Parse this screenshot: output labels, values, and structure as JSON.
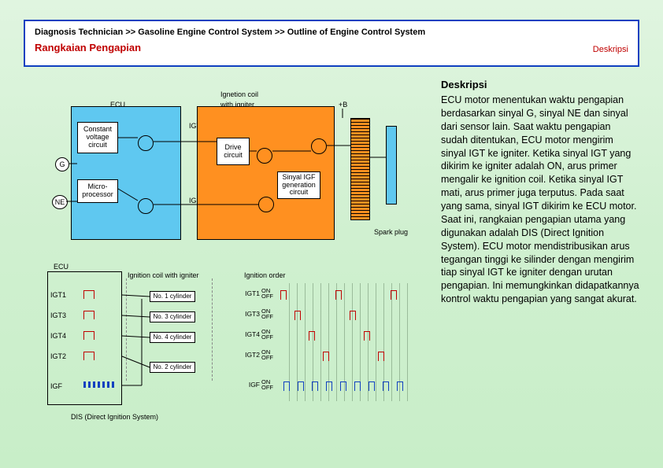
{
  "header": {
    "breadcrumb": "Diagnosis Technician >> Gasoline Engine Control System >> Outline of Engine Control System",
    "subtitle": "Rangkaian Pengapian",
    "right_label": "Deskripsi"
  },
  "diagram_top": {
    "title_ignetion": "Ignetion coil",
    "title_with_igniter": "with igniter",
    "ecu_label": "ECU",
    "plus_b": "+B",
    "cvc": "Constant voltage circuit",
    "micro": "Micro-processor",
    "drive": "Drive circuit",
    "igf_gen": "Sinyal IGF generation circuit",
    "igt": "IGT",
    "igf": "IGF",
    "g": "G",
    "ne": "NE",
    "spark": "Spark plug"
  },
  "diagram_bottom": {
    "ecu": "ECU",
    "signals": [
      {
        "name": "IGT1",
        "color": "red"
      },
      {
        "name": "IGT3",
        "color": "red"
      },
      {
        "name": "IGT4",
        "color": "red"
      },
      {
        "name": "IGT2",
        "color": "red"
      },
      {
        "name": "IGF",
        "color": "blue"
      }
    ],
    "ign_coil_title": "Ignition coil with igniter",
    "cylinders": [
      "No. 1 cylinder",
      "No. 3 cylinder",
      "No. 4 cylinder",
      "No. 2 cylinder"
    ],
    "order_title": "Ignition order",
    "order": [
      {
        "name": "IGT1",
        "on": "ON",
        "off": "OFF"
      },
      {
        "name": "IGT3",
        "on": "ON",
        "off": "OFF"
      },
      {
        "name": "IGT4",
        "on": "ON",
        "off": "OFF"
      },
      {
        "name": "IGT2",
        "on": "ON",
        "off": "OFF"
      },
      {
        "name": "IGF",
        "on": "ON",
        "off": "OFF"
      }
    ],
    "dis_label": "DIS (Direct Ignition System)"
  },
  "description": {
    "heading": "Deskripsi",
    "body": "ECU motor menentukan waktu pengapian berdasarkan sinyal G, sinyal NE dan sinyal dari sensor lain. Saat waktu pengapian sudah ditentukan, ECU motor mengirim sinyal IGT ke igniter. Ketika sinyal IGT yang dikirim ke igniter adalah ON, arus primer mengalir ke ignition coil. Ketika sinyal IGT mati, arus primer juga terputus. Pada saat yang sama, sinyal IGT dikirim ke ECU motor. Saat ini, rangkaian pengapian utama yang digunakan adalah DIS (Direct Ignition System). ECU motor mendistribusikan arus tegangan tinggi ke silinder dengan mengirim tiap sinyal IGT ke igniter dengan urutan pengapian. Ini memungkinkan didapatkannya kontrol waktu pengapian yang sangat akurat."
  }
}
